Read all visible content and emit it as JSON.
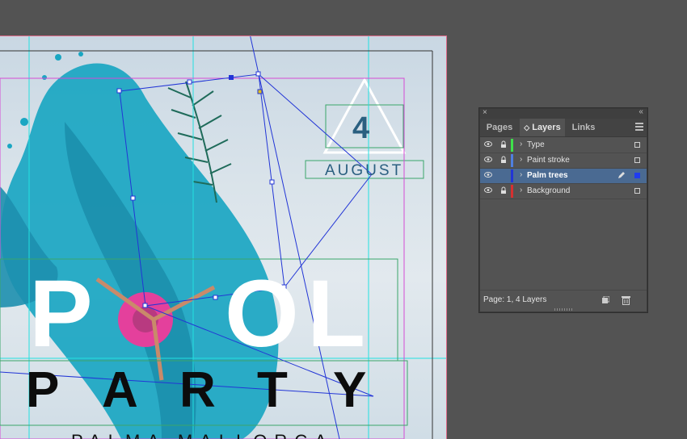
{
  "artwork": {
    "headline_letters": [
      "P",
      "O",
      "L"
    ],
    "party_letters": [
      "P",
      "A",
      "R",
      "T",
      "Y"
    ],
    "date_number": "4",
    "date_month": "AUGUST",
    "subtitle": "PALMA MALLORCA"
  },
  "layers_panel": {
    "close_glyph": "×",
    "collapse_glyph": "‹‹",
    "tabs": [
      {
        "label": "Pages",
        "active": false
      },
      {
        "label": "Layers",
        "active": true,
        "sort_glyph": "◇"
      },
      {
        "label": "Links",
        "active": false
      }
    ],
    "menu_icon": "hamburger-menu-icon",
    "layers": [
      {
        "name": "Type",
        "visible": true,
        "locked": true,
        "color": "#3fe04a",
        "selected": false
      },
      {
        "name": "Paint stroke",
        "visible": true,
        "locked": true,
        "color": "#4f7fe0",
        "selected": false
      },
      {
        "name": "Palm trees",
        "visible": true,
        "locked": false,
        "color": "#2235d6",
        "selected": true
      },
      {
        "name": "Background",
        "visible": true,
        "locked": true,
        "color": "#d63030",
        "selected": false
      }
    ],
    "status": "Page: 1, 4 Layers"
  },
  "colors": {
    "workspace": "#535353",
    "selection_blue": "#2235d6",
    "guide_cyan": "#22e0e0",
    "margin_magenta": "#d54bd5",
    "paint_teal": "#1aa6c2"
  }
}
